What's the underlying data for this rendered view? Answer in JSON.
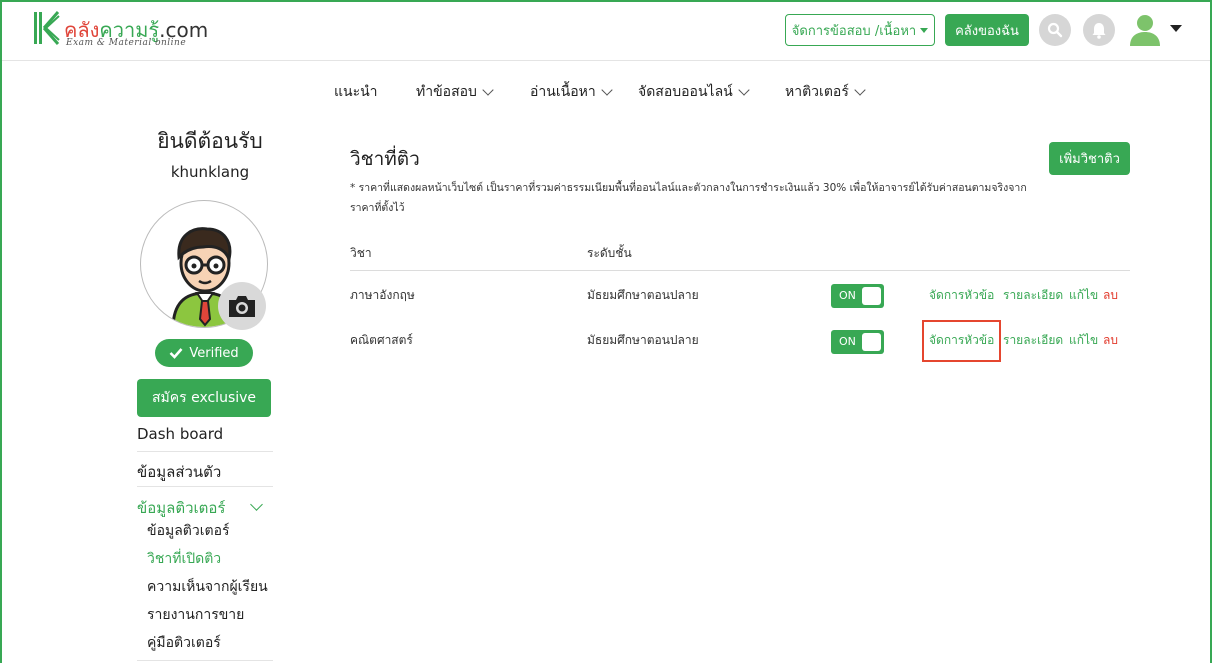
{
  "header": {
    "logo_main_1": "คลัง",
    "logo_main_2": "ความรู้",
    "logo_main_3": ".com",
    "logo_sub": "Exam & Material online",
    "manage_label": "จัดการข้อสอบ /เนื้อหา",
    "mine_label": "คลังของฉัน"
  },
  "nav": {
    "items": [
      {
        "label": "แนะนำ",
        "has_dropdown": false
      },
      {
        "label": "ทำข้อสอบ",
        "has_dropdown": true
      },
      {
        "label": "อ่านเนื้อหา",
        "has_dropdown": true
      },
      {
        "label": "จัดสอบออนไลน์",
        "has_dropdown": true
      },
      {
        "label": "หาติวเตอร์",
        "has_dropdown": true
      }
    ]
  },
  "profile": {
    "welcome": "ยินดีต้อนรับ",
    "username": "khunklang",
    "verified": "Verified",
    "exclusive": "สมัคร exclusive"
  },
  "sidebar": {
    "dashboard": "Dash board",
    "personal": "ข้อมูลส่วนตัว",
    "tutor_info": "ข้อมูลติวเตอร์",
    "sub": [
      {
        "label": "ข้อมูลติวเตอร์",
        "active": false
      },
      {
        "label": "วิชาที่เปิดติว",
        "active": true
      },
      {
        "label": "ความเห็นจากผู้เรียน",
        "active": false
      },
      {
        "label": "รายงานการขาย",
        "active": false
      },
      {
        "label": "คู่มือติวเตอร์",
        "active": false
      }
    ]
  },
  "main": {
    "title": "วิชาที่ติว",
    "add_button": "เพิ่มวิชาติว",
    "note": "* ราคาที่แสดงผลหน้าเว็บไซต์ เป็นราคาที่รวมค่าธรรมเนียมพื้นที่ออนไลน์และตัวกลางในการชำระเงินแล้ว 30% เพื่อให้อาจารย์ได้รับค่าสอนตามจริงจากราคาที่ตั้งไว้",
    "columns": {
      "subject": "วิชา",
      "level": "ระดับชั้น"
    },
    "rows": [
      {
        "subject": "ภาษาอังกฤษ",
        "level": "มัธยมศึกษาตอนปลาย",
        "toggle": "ON",
        "manage": "จัดการหัวข้อ",
        "detail": "รายละเอียด",
        "edit": "แก้ไข",
        "delete": "ลบ"
      },
      {
        "subject": "คณิตศาสตร์",
        "level": "มัธยมศึกษาตอนปลาย",
        "toggle": "ON",
        "manage": "จัดการหัวข้อ",
        "detail": "รายละเอียด",
        "edit": "แก้ไข",
        "delete": "ลบ"
      }
    ]
  },
  "colors": {
    "accent": "#38a854",
    "danger": "#e23a2c",
    "highlight": "#e5462f"
  }
}
